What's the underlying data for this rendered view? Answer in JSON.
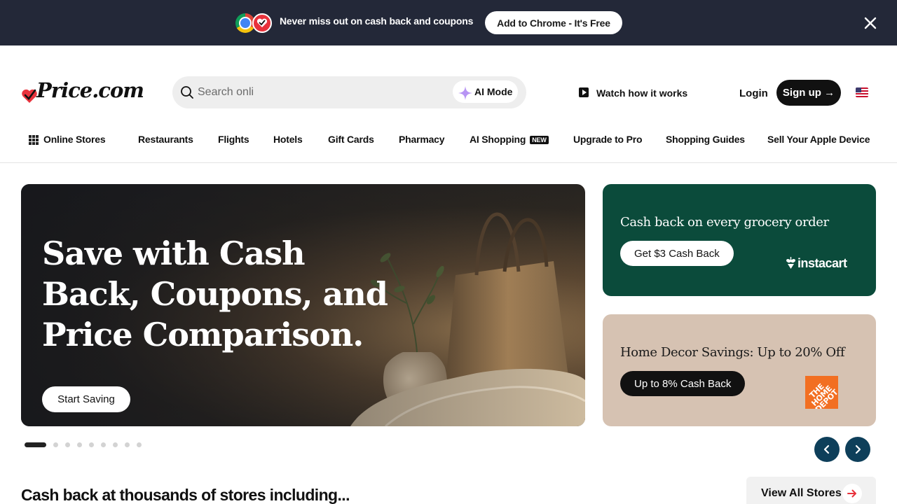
{
  "promo_banner": {
    "message": "Never miss out on cash back and coupons",
    "button_label": "Add to Chrome - It's Free",
    "icons": [
      "chrome-icon",
      "price-app-icon",
      "close-icon"
    ]
  },
  "header": {
    "brand": "Price.com",
    "search": {
      "value": "",
      "placeholder": "Search onli",
      "ai_mode_label": "AI Mode"
    },
    "watch_label": "Watch how it works",
    "login_label": "Login",
    "signup_label": "Sign up →",
    "locale_icon": "us-flag-icon"
  },
  "nav": {
    "items": [
      {
        "label": "Online Stores"
      },
      {
        "label": "Restaurants"
      },
      {
        "label": "Flights"
      },
      {
        "label": "Hotels"
      },
      {
        "label": "Gift Cards"
      },
      {
        "label": "Pharmacy"
      },
      {
        "label": "AI Shopping",
        "badge": "NEW"
      },
      {
        "label": "Upgrade to Pro"
      },
      {
        "label": "Shopping Guides"
      },
      {
        "label": "Sell Your Apple Device"
      }
    ]
  },
  "hero": {
    "title": "Save with Cash Back, Coupons, and Price Comparison.",
    "button_label": "Start Saving",
    "slide_count": 10,
    "active_slide": 1
  },
  "side_promos": [
    {
      "title": "Cash back on every grocery order",
      "button_label": "Get $3 Cash Back",
      "brand": "instacart",
      "bg_color": "#0b4b3b"
    },
    {
      "title": "Home Decor Savings: Up to 20% Off",
      "button_label": "Up to 8% Cash Back",
      "brand": "THE HOME DEPOT",
      "bg_color": "#d6c2b2"
    }
  ],
  "stores_section": {
    "heading": "Cash back at thousands of stores including...",
    "view_all_label": "View All Stores"
  },
  "colors": {
    "banner_bg": "#232838",
    "accent_red": "#e8323c",
    "carousel_arrow": "#0e3f5a"
  }
}
